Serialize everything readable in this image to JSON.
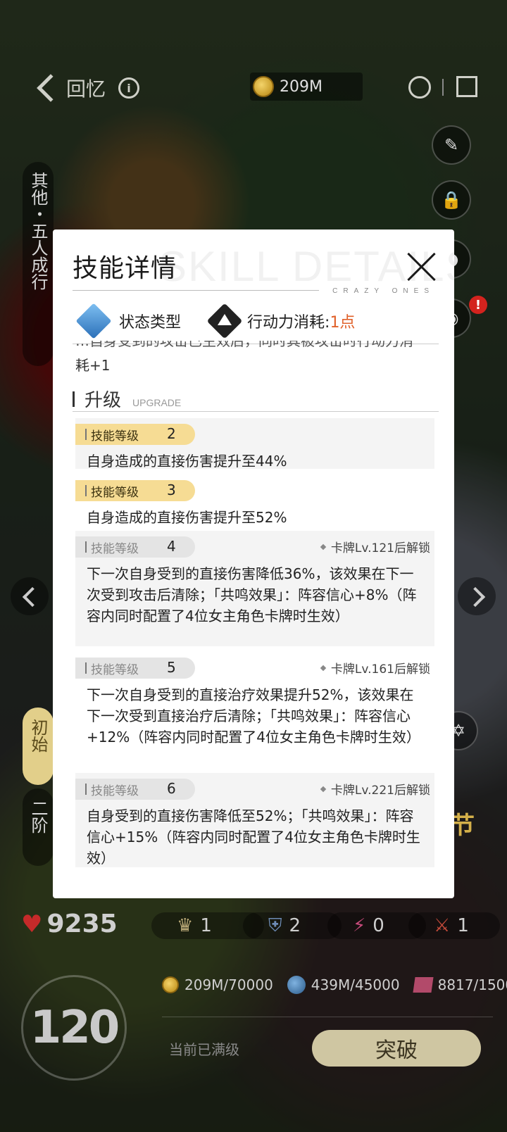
{
  "topbar": {
    "back_label": "回忆",
    "currency": "209M"
  },
  "left_tabs": {
    "other_label": "其他・五人成行",
    "initial_label": "初始",
    "stage2_label": "二阶"
  },
  "side_icons": [
    {
      "name": "skin-icon"
    },
    {
      "name": "lock-icon"
    },
    {
      "name": "mic-icon"
    },
    {
      "name": "film-icon",
      "badge": "!"
    }
  ],
  "stats": {
    "hp": "9235",
    "crown": "1",
    "shield": "2",
    "bolt": "0",
    "swords": "1"
  },
  "resources": [
    {
      "icon": "gold-coin-icon",
      "value": "209M/70000"
    },
    {
      "icon": "blue-coin-icon",
      "value": "439M/45000"
    },
    {
      "icon": "crystal-icon",
      "value": "8817/1500"
    }
  ],
  "level": "120",
  "max_label": "当前已满级",
  "breakthrough_label": "突破",
  "festival_label": "节",
  "dialog": {
    "title": "技能详情",
    "watermark": "SKILL DETAILS",
    "subtitle": "CRAZY ONES",
    "skill_type": "状态类型",
    "cost_label": "行动力消耗:",
    "cost_value": "1点",
    "cut_text_top": "…自身受到的攻击已生效后，同时其被攻击时行动力消",
    "cut_text_line": "耗+1",
    "upgrade_title": "升级",
    "upgrade_en": "UPGRADE",
    "levels": [
      {
        "label": "技能等级",
        "num": "2",
        "unlocked": true,
        "lock": "",
        "desc": "自身造成的直接伤害提升至44%"
      },
      {
        "label": "技能等级",
        "num": "3",
        "unlocked": true,
        "lock": "",
        "desc": "自身造成的直接伤害提升至52%"
      },
      {
        "label": "技能等级",
        "num": "4",
        "unlocked": false,
        "lock": "卡牌Lv.121后解锁",
        "desc": "下一次自身受到的直接伤害降低36%，该效果在下一次受到攻击后清除；「共鸣效果」：阵容信心+8%（阵容内同时配置了4位女主角色卡牌时生效）"
      },
      {
        "label": "技能等级",
        "num": "5",
        "unlocked": false,
        "lock": "卡牌Lv.161后解锁",
        "desc": "下一次自身受到的直接治疗效果提升52%，该效果在下一次受到直接治疗后清除；「共鸣效果」：阵容信心+12%（阵容内同时配置了4位女主角色卡牌时生效）"
      },
      {
        "label": "技能等级",
        "num": "6",
        "unlocked": false,
        "lock": "卡牌Lv.221后解锁",
        "desc": "自身受到的直接伤害降低至52%；「共鸣效果」：阵容信心+15%（阵容内同时配置了4位女主角色卡牌时生效）"
      }
    ]
  },
  "colors": {
    "accent_orange": "#e0612a",
    "pill_gold": "#f6dc94",
    "badge_red": "#d3231e"
  }
}
